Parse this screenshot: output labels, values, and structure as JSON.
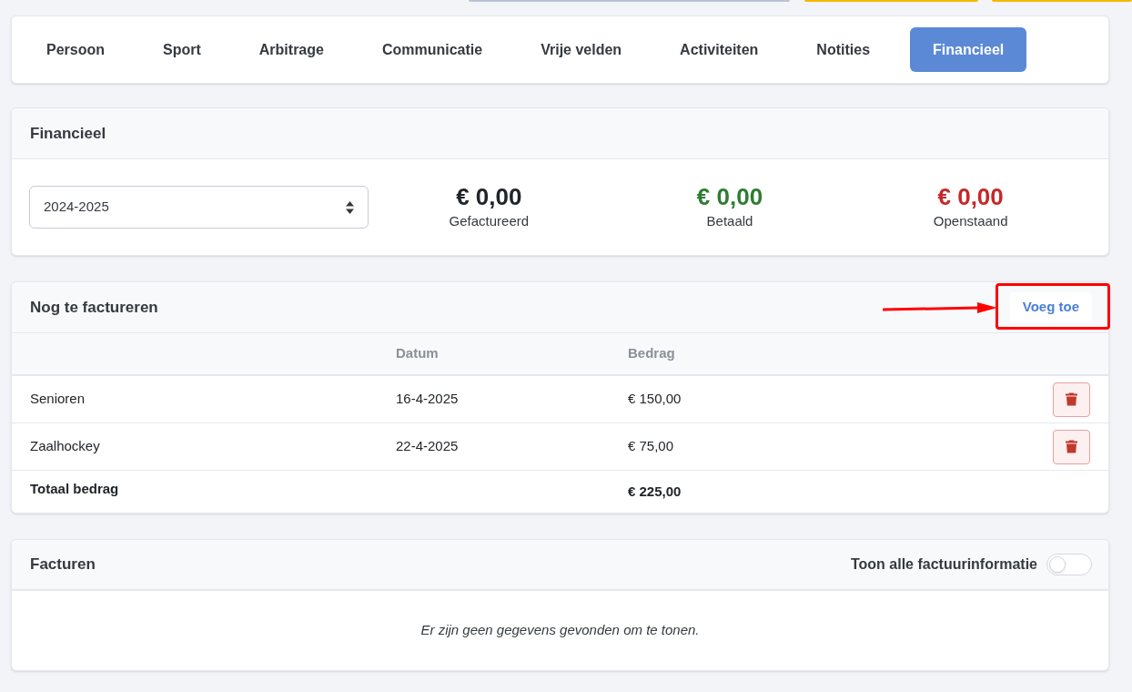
{
  "tabs": [
    {
      "label": "Persoon",
      "selected": false
    },
    {
      "label": "Sport",
      "selected": false
    },
    {
      "label": "Arbitrage",
      "selected": false
    },
    {
      "label": "Communicatie",
      "selected": false
    },
    {
      "label": "Vrije velden",
      "selected": false
    },
    {
      "label": "Activiteiten",
      "selected": false
    },
    {
      "label": "Notities",
      "selected": false
    },
    {
      "label": "Financieel",
      "selected": true
    }
  ],
  "summary": {
    "title": "Financieel",
    "season": "2024-2025",
    "totals": [
      {
        "amount": "€ 0,00",
        "label": "Gefactureerd",
        "color": "#212529"
      },
      {
        "amount": "€ 0,00",
        "label": "Betaald",
        "color": "#2e7d32"
      },
      {
        "amount": "€ 0,00",
        "label": "Openstaand",
        "color": "#c62828"
      }
    ]
  },
  "to_invoice": {
    "title": "Nog te factureren",
    "add_button": "Voeg toe",
    "highlighted": true,
    "columns": [
      "Datum",
      "Bedrag"
    ],
    "rows": [
      {
        "name": "Senioren",
        "date": "16-4-2025",
        "amount": "€ 150,00"
      },
      {
        "name": "Zaalhockey",
        "date": "22-4-2025",
        "amount": "€ 75,00"
      }
    ],
    "total": {
      "label": "Totaal bedrag",
      "amount": "€ 225,00"
    }
  },
  "invoices": {
    "title": "Facturen",
    "toggle_label": "Toon alle factuurinformatie",
    "toggle_on": false,
    "empty_message": "Er zijn geen gegevens gevonden om te tonen."
  }
}
